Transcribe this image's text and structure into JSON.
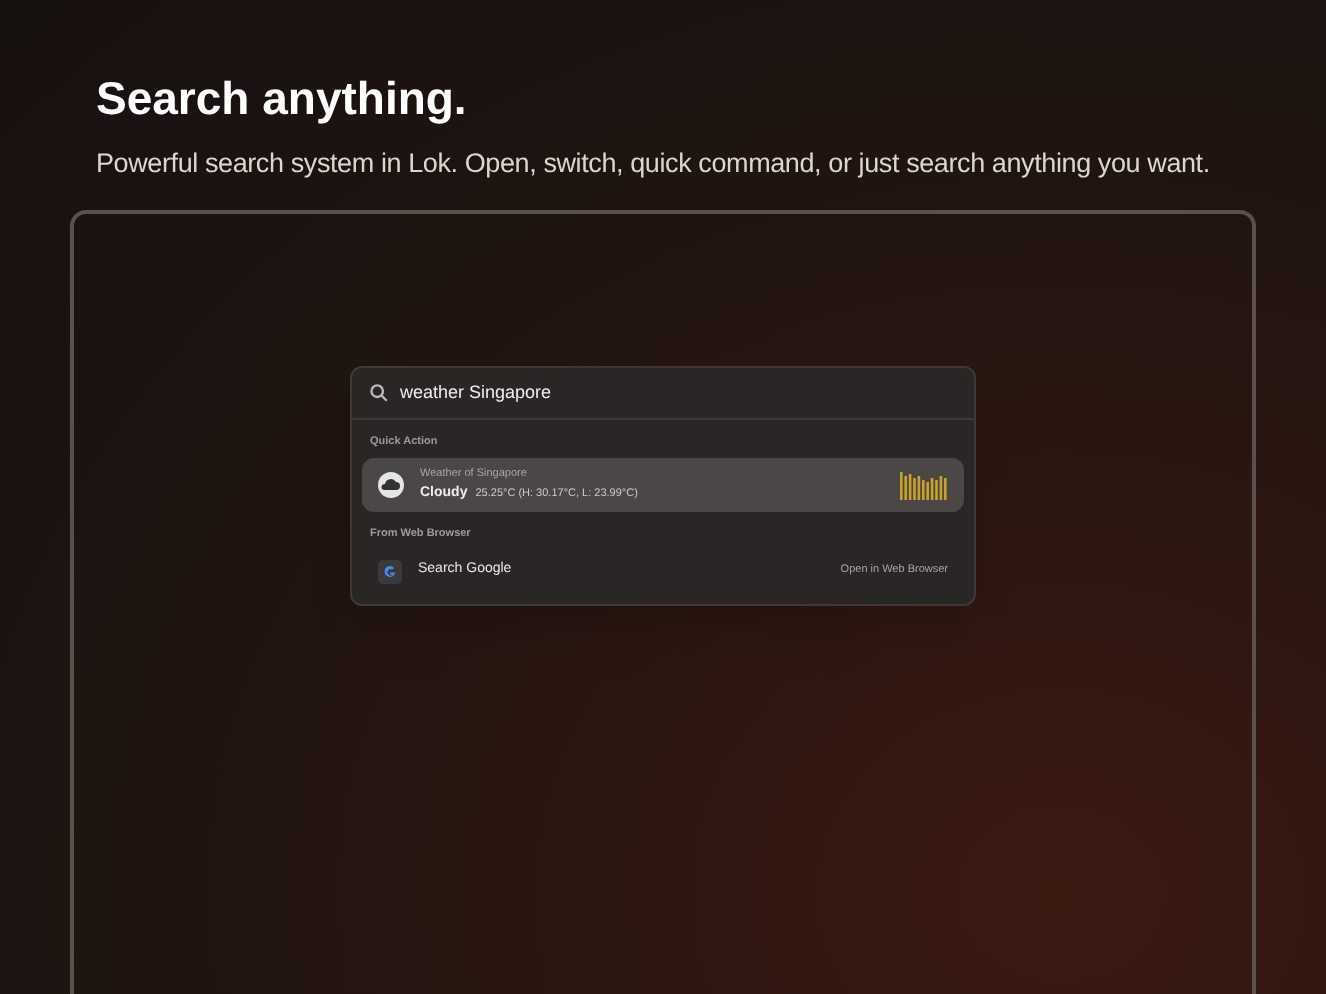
{
  "title": "Search anything.",
  "subtitle": "Powerful search system in Lok. Open, switch, quick command, or just search anything you want.",
  "search": {
    "value": "weather Singapore"
  },
  "sections": [
    {
      "heading": "Quick Action",
      "items": [
        {
          "kind": "weather",
          "selected": true,
          "caption": "Weather of Singapore",
          "title": "Cloudy",
          "detail": "25.25°C (H: 30.17°C, L: 23.99°C)"
        }
      ]
    },
    {
      "heading": "From Web Browser",
      "items": [
        {
          "kind": "web",
          "selected": false,
          "title": "Search Google",
          "hint": "Open in Web Browser"
        }
      ]
    }
  ]
}
